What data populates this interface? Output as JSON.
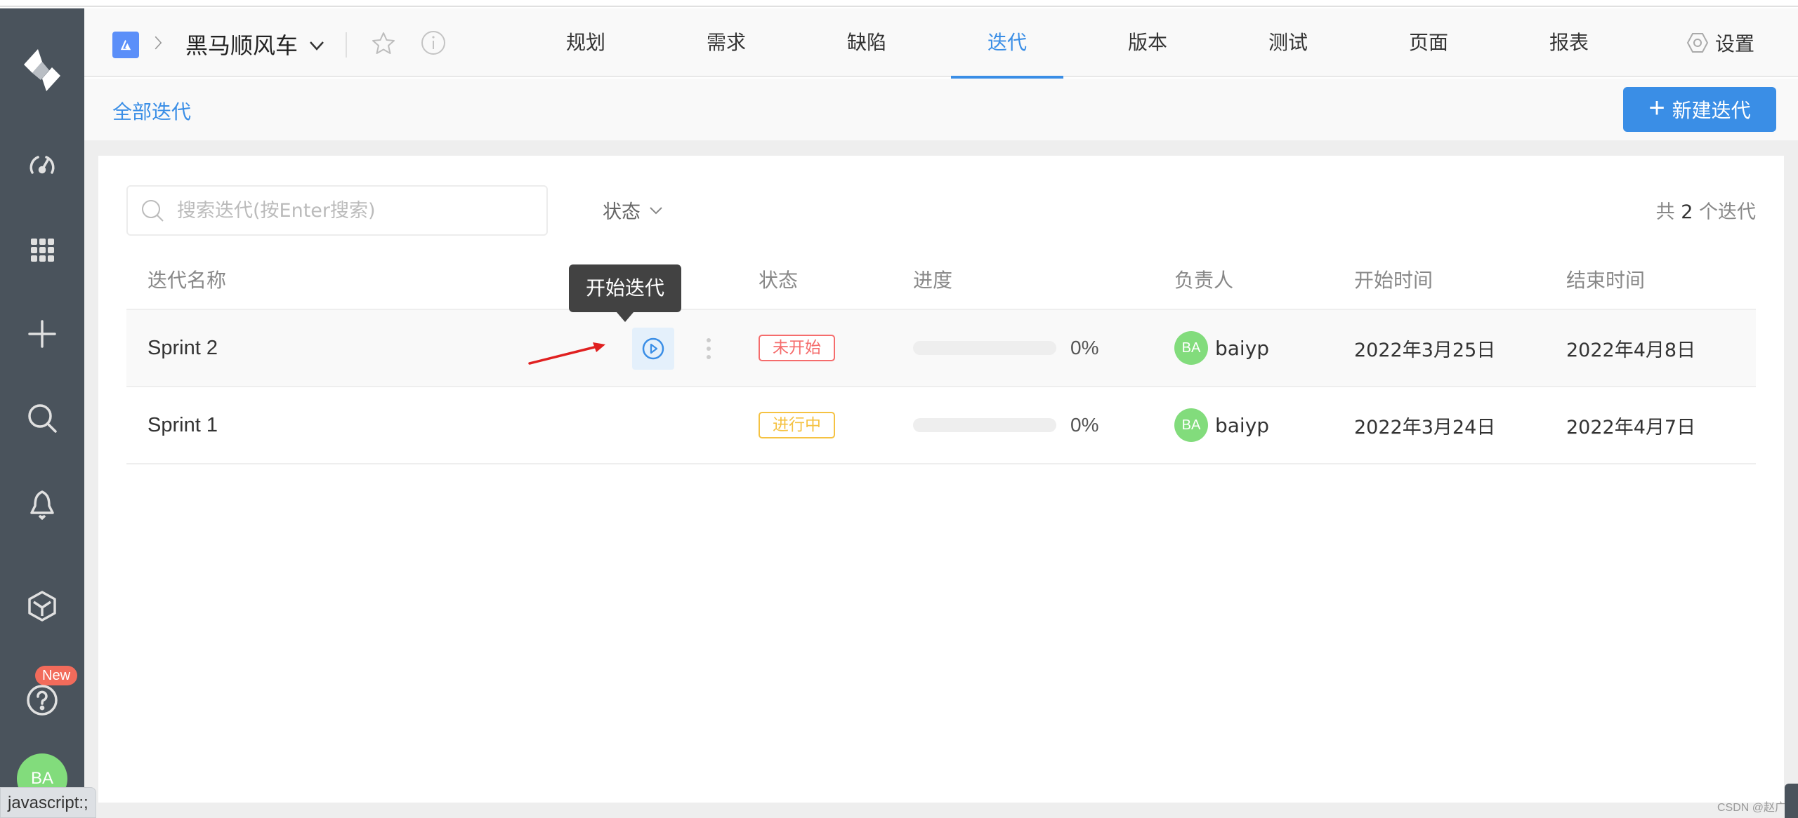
{
  "sidebar": {
    "items": [
      {
        "name": "dashboard",
        "icon": "gauge-icon"
      },
      {
        "name": "apps",
        "icon": "grid-icon"
      },
      {
        "name": "create",
        "icon": "plus-icon"
      },
      {
        "name": "search",
        "icon": "search-icon"
      },
      {
        "name": "notifications",
        "icon": "bell-icon"
      },
      {
        "name": "products",
        "icon": "cube-icon"
      },
      {
        "name": "help",
        "icon": "question-icon"
      }
    ],
    "new_badge": "New",
    "avatar_initials": "BA"
  },
  "header": {
    "project_name": "黑马顺风车",
    "tabs": [
      {
        "label": "规划",
        "active": false
      },
      {
        "label": "需求",
        "active": false
      },
      {
        "label": "缺陷",
        "active": false
      },
      {
        "label": "迭代",
        "active": true
      },
      {
        "label": "版本",
        "active": false
      },
      {
        "label": "测试",
        "active": false
      },
      {
        "label": "页面",
        "active": false
      },
      {
        "label": "报表",
        "active": false
      }
    ],
    "settings_label": "设置"
  },
  "subheader": {
    "all_label": "全部迭代",
    "new_button_label": "新建迭代"
  },
  "toolbar": {
    "search_placeholder": "搜索迭代(按Enter搜索)",
    "search_value": "",
    "status_filter_label": "状态",
    "total_prefix": "共",
    "total_count": "2",
    "total_suffix": "个迭代"
  },
  "table": {
    "columns": [
      "迭代名称",
      "状态",
      "进度",
      "负责人",
      "开始时间",
      "结束时间"
    ],
    "rows": [
      {
        "name": "Sprint 2",
        "status": "未开始",
        "status_color": "#f56c6c",
        "progress": 0,
        "progress_label": "0%",
        "owner_initials": "BA",
        "owner": "baiyp",
        "start": "2022年3月25日",
        "end": "2022年4月8日"
      },
      {
        "name": "Sprint 1",
        "status": "进行中",
        "status_color": "#f5c242",
        "progress": 0,
        "progress_label": "0%",
        "owner_initials": "BA",
        "owner": "baiyp",
        "start": "2022年3月24日",
        "end": "2022年4月7日"
      }
    ]
  },
  "tooltip": "开始迭代",
  "statusbar_text": "javascript:;",
  "watermark": "CSDN @赵广陆",
  "colors": {
    "accent": "#3a8ee6",
    "sidebar": "#4a535c",
    "avatar": "#82dc7c",
    "annotation_arrow": "#e02020"
  }
}
